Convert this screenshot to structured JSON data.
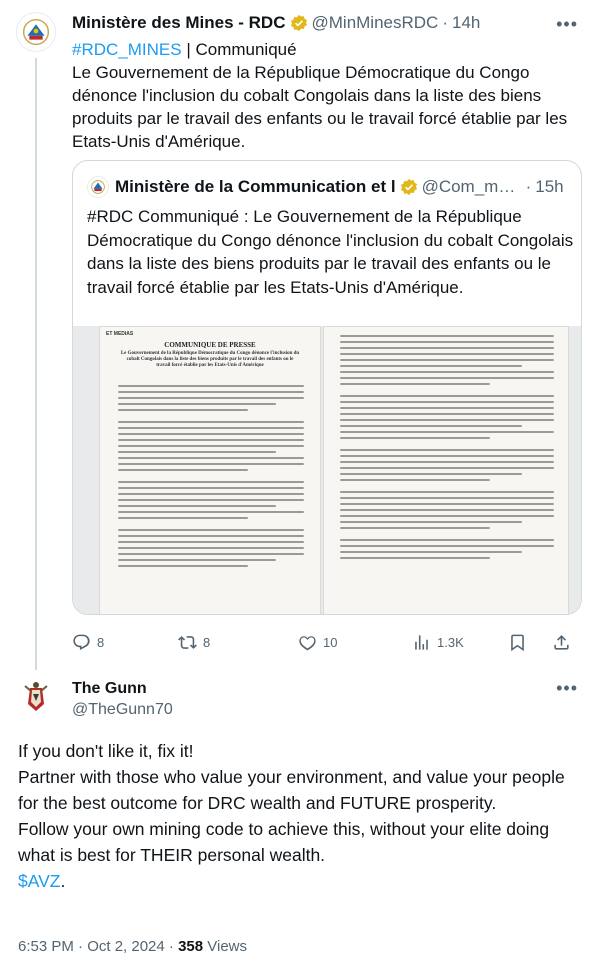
{
  "tweet1": {
    "name": "Ministère des Mines - RDC",
    "handle": "@MinMinesRDC",
    "time": "14h",
    "hashtag": "#RDC_MINES",
    "label": " | Communiqué",
    "text": "Le Gouvernement de la République Démocratique du Congo dénonce l'inclusion du cobalt Congolais dans la liste des biens produits par le travail des enfants ou le travail forcé établie par les Etats-Unis d'Amérique.",
    "quote": {
      "name": "Ministère de la Communication et l",
      "handle": "@Com_media",
      "time": "15h",
      "text": "#RDC Communiqué : Le Gouvernement de la République Démocratique du Congo dénonce l'inclusion du cobalt Congolais dans la liste des biens produits par le travail des enfants ou le travail forcé établie par les Etats-Unis d'Amérique.",
      "doc": {
        "tag": "ET MEDIAS",
        "title": "COMMUNIQUE DE PRESSE",
        "heading": "Le Gouvernement de la République Démocratique du Congo dénonce l'inclusion du cobalt Congolais dans la liste des biens produits par le travail des enfants ou le travail forcé établie par les Etats-Unis d'Amérique"
      }
    },
    "stats": {
      "replies": "8",
      "reposts": "8",
      "likes": "10",
      "views": "1.3K"
    }
  },
  "tweet2": {
    "name": "The Gunn",
    "handle": "@TheGunn70",
    "lines": [
      "If you don't like it, fix it!",
      "Partner with those who value your environment, and value your people for the best outcome for DRC wealth and FUTURE prosperity.",
      "Follow your own mining code to achieve this, without your elite doing what is best for THEIR personal wealth."
    ],
    "cashtag": "$AVZ",
    "cashtag_suffix": ".",
    "timestamp": "6:53 PM · Oct 2, 2024 · ",
    "views_count": "358",
    "views_label": " Views"
  },
  "colors": {
    "accent": "#1d9bf0",
    "muted": "#536471",
    "border": "#cfd9de",
    "gold_badge": "#e2b719"
  },
  "icons": [
    "verified-gold-badge-icon",
    "more-icon",
    "reply-icon",
    "retweet-icon",
    "like-icon",
    "views-icon",
    "bookmark-icon",
    "share-icon"
  ]
}
